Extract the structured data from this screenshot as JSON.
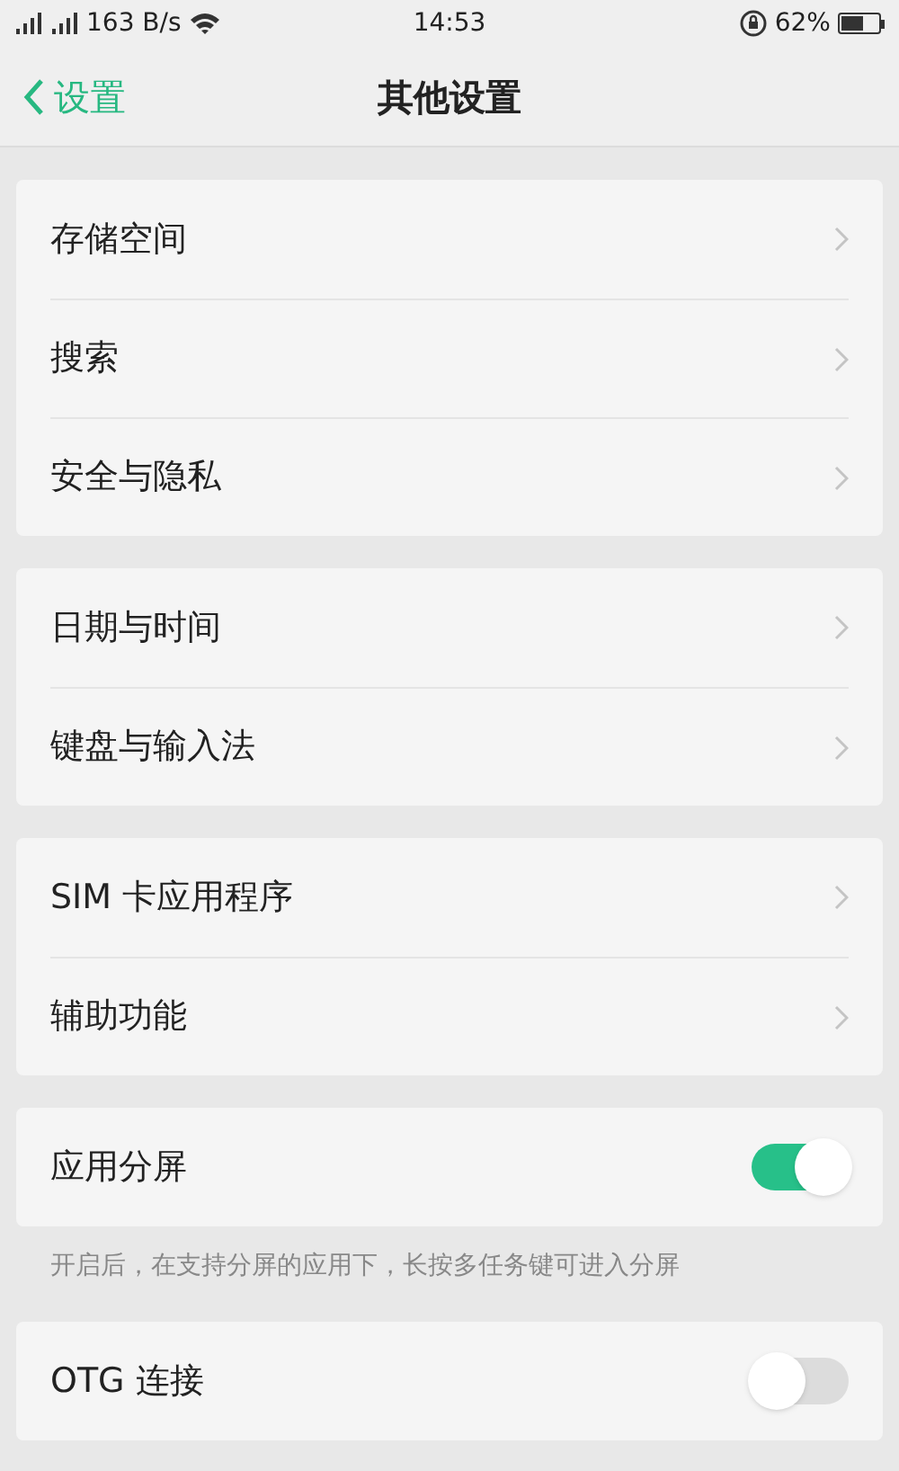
{
  "status_bar": {
    "network_speed": "163 B/s",
    "time": "14:53",
    "battery_percent": "62%"
  },
  "nav": {
    "back_label": "设置",
    "title": "其他设置"
  },
  "groups": [
    {
      "rows": [
        {
          "kind": "link",
          "label": "存储空间"
        },
        {
          "kind": "link",
          "label": "搜索"
        },
        {
          "kind": "link",
          "label": "安全与隐私"
        }
      ]
    },
    {
      "rows": [
        {
          "kind": "link",
          "label": "日期与时间"
        },
        {
          "kind": "link",
          "label": "键盘与输入法"
        }
      ]
    },
    {
      "rows": [
        {
          "kind": "link",
          "label": "SIM 卡应用程序"
        },
        {
          "kind": "link",
          "label": "辅助功能"
        }
      ]
    },
    {
      "rows": [
        {
          "kind": "toggle",
          "label": "应用分屏",
          "on": true
        }
      ],
      "note": "开启后，在支持分屏的应用下，长按多任务键可进入分屏"
    },
    {
      "rows": [
        {
          "kind": "toggle",
          "label": "OTG 连接",
          "on": false
        }
      ]
    }
  ]
}
